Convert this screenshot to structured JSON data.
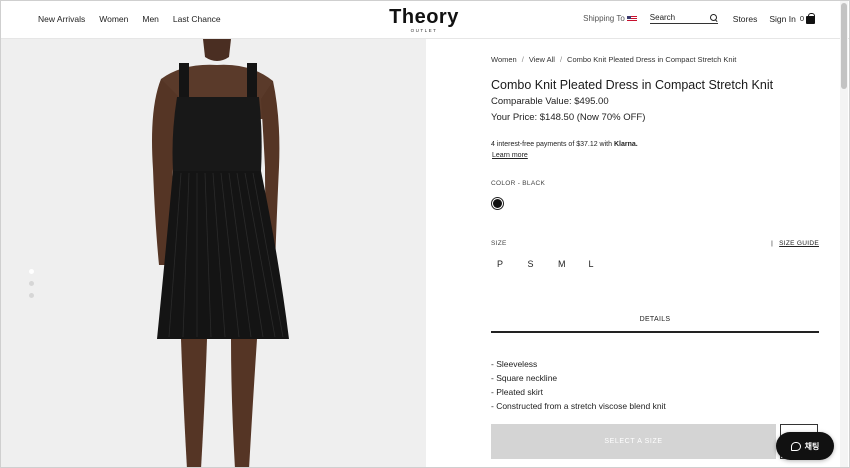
{
  "header": {
    "nav": [
      "New Arrivals",
      "Women",
      "Men",
      "Last Chance"
    ],
    "logo_main": "Theory",
    "logo_sub": "OUTLET",
    "shipping_label": "Shipping To",
    "search_label": "Search",
    "stores_label": "Stores",
    "signin_label": "Sign In",
    "bag_count": "0"
  },
  "breadcrumb": [
    "Women",
    "View All",
    "Combo Knit Pleated Dress in Compact Stretch Knit"
  ],
  "product": {
    "title": "Combo Knit Pleated Dress in Compact Stretch Knit",
    "comparable_value": "Comparable Value: $495.00",
    "your_price": "Your Price: $148.50 (Now 70% OFF)",
    "klarna_text": "4 interest-free payments of $37.12 with",
    "klarna_brand": "Klarna.",
    "learn_more": "Learn more",
    "color_label": "COLOR -",
    "color_value": "BLACK",
    "size_label": "SIZE",
    "size_guide_sep": "|",
    "size_guide": "SIZE GUIDE",
    "sizes": [
      "P",
      "S",
      "M",
      "L"
    ],
    "details_tab": "DETAILS",
    "details": [
      "- Sleeveless",
      "- Square neckline",
      "- Pleated skirt",
      "- Constructed from a stretch viscose blend knit"
    ],
    "select_size": "SELECT A SIZE"
  },
  "chat_label": "채팅",
  "gallery": {
    "dot_count": 3,
    "active_dot": 0
  },
  "colors": {
    "accent": "#111111",
    "disabled_button": "#d4d4d4",
    "gallery_bg": "#efefef"
  }
}
